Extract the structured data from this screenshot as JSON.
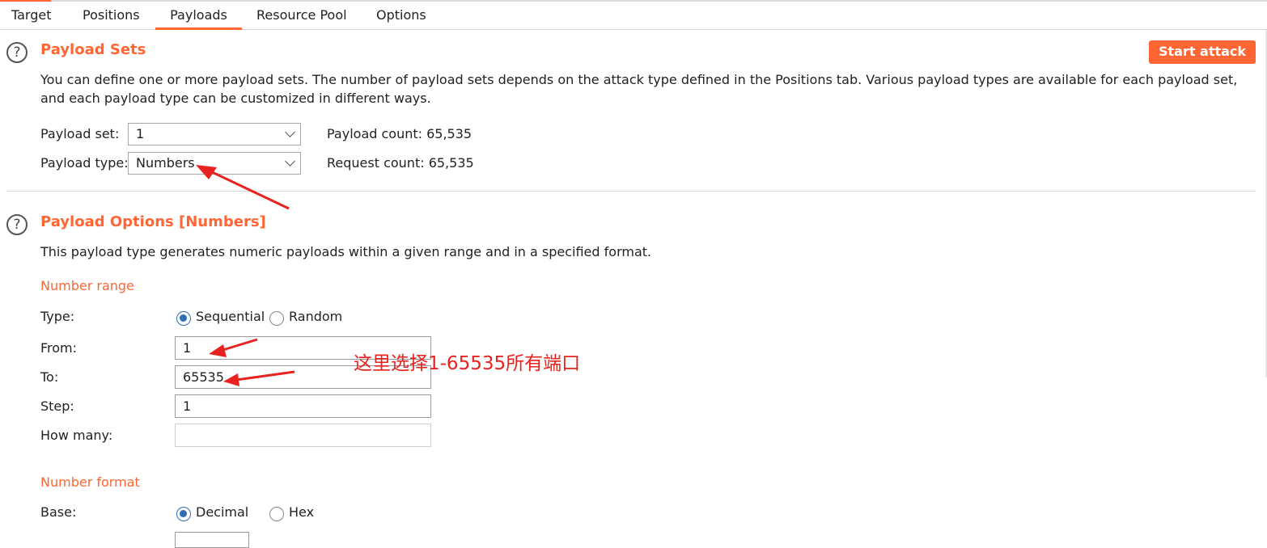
{
  "tabs": [
    "Target",
    "Positions",
    "Payloads",
    "Resource Pool",
    "Options"
  ],
  "payload_sets": {
    "title": "Payload Sets",
    "description": "You can define one or more payload sets. The number of payload sets depends on the attack type defined in the Positions tab. Various payload types are available for each payload set, and each payload type can be customized in different ways.",
    "set_label": "Payload set:",
    "set_value": "1",
    "type_label": "Payload type:",
    "type_value": "Numbers",
    "payload_count": "Payload count: 65,535",
    "request_count": "Request count: 65,535",
    "start_button": "Start attack"
  },
  "payload_options": {
    "title": "Payload Options [Numbers]",
    "description": "This payload type generates numeric payloads within a given range and in a specified format.",
    "number_range": {
      "heading": "Number range",
      "type_label": "Type:",
      "sequential": "Sequential",
      "random": "Random",
      "from_label": "From:",
      "from_value": "1",
      "to_label": "To:",
      "to_value": "65535",
      "step_label": "Step:",
      "step_value": "1",
      "how_many_label": "How many:",
      "how_many_value": ""
    },
    "number_format": {
      "heading": "Number format",
      "base_label": "Base:",
      "decimal": "Decimal",
      "hex": "Hex"
    }
  },
  "annotation": "这里选择1-65535所有端口",
  "colors": {
    "accent": "#ff6633",
    "radio": "#2f6db5",
    "annotation": "#e8231f"
  }
}
